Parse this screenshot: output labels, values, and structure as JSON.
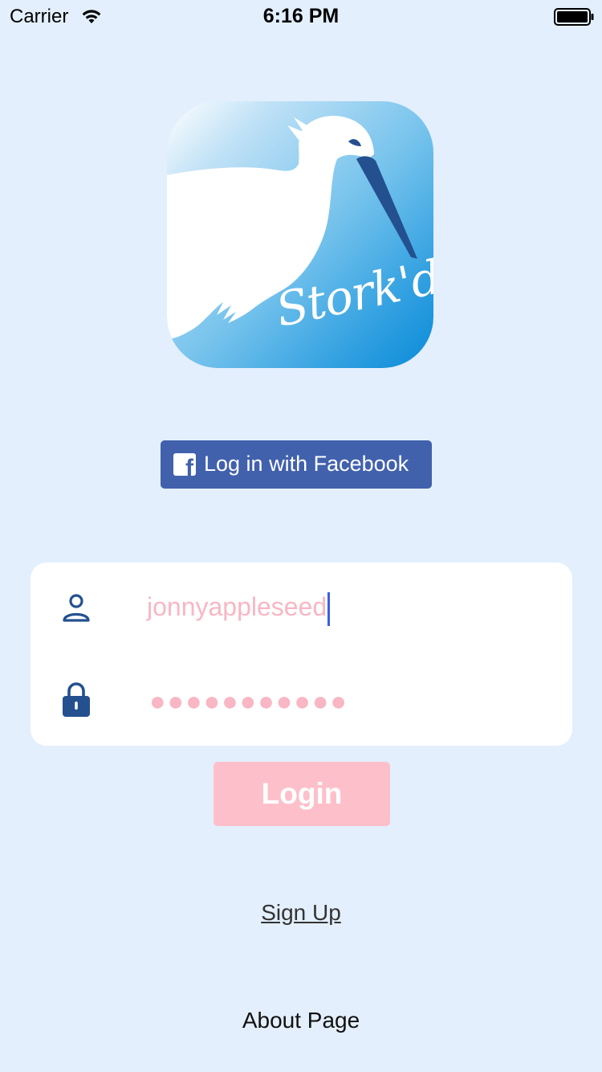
{
  "status_bar": {
    "carrier": "Carrier",
    "time": "6:16 PM",
    "icons": [
      "wifi-icon",
      "battery-icon"
    ]
  },
  "app_icon": {
    "brand": "Stork'd",
    "colors": {
      "gradient_start": "#ffffff",
      "gradient_end": "#0b8bd9",
      "beak": "#24508f"
    }
  },
  "facebook_login": {
    "label": "Log in with Facebook",
    "icon": "facebook-icon",
    "color": "#4161ad"
  },
  "login_form": {
    "username": {
      "icon": "user-icon",
      "value": "jonnyappleseed"
    },
    "password": {
      "icon": "lock-icon",
      "masked_value": "●●●●●●●●●●●"
    },
    "submit_label": "Login",
    "submit_color": "#fdc0cb",
    "input_text_color": "#f9b6c4",
    "icon_color": "#24508f"
  },
  "links": {
    "sign_up": "Sign Up",
    "about": "About Page"
  },
  "background_color": "#e3effd"
}
